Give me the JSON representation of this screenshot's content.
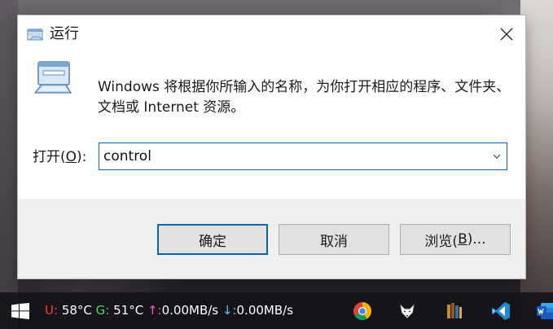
{
  "dialog": {
    "title": "运行",
    "description": "Windows 将根据你所输入的名称，为你打开相应的程序、文件夹、文档或 Internet 资源。",
    "open_label_prefix": "打开(",
    "open_label_key": "O",
    "open_label_suffix": "):",
    "input_value": "control",
    "buttons": {
      "ok": "确定",
      "cancel": "取消",
      "browse_prefix": "浏览(",
      "browse_key": "B",
      "browse_suffix": ")..."
    }
  },
  "taskbar": {
    "u_label": "U:",
    "u_value": "58°C",
    "g_label": "G:",
    "g_value": "51°C",
    "up_arrow": "↑:",
    "up_value": "0.00MB/s",
    "down_arrow": "↓:",
    "down_value": "0.00MB/s",
    "icons": [
      "windows-start-icon",
      "chrome-icon",
      "fox-app-icon",
      "books-app-icon",
      "vscode-icon",
      "word-icon"
    ]
  },
  "colors": {
    "accent": "#0a64b4",
    "footer_bg": "#f0f0f0",
    "button_bg": "#e1e1e1",
    "u_label": "#ff3b30",
    "g_label": "#4cd964",
    "up_arrow": "#ff4fd8",
    "down_arrow": "#5ac8fa"
  }
}
